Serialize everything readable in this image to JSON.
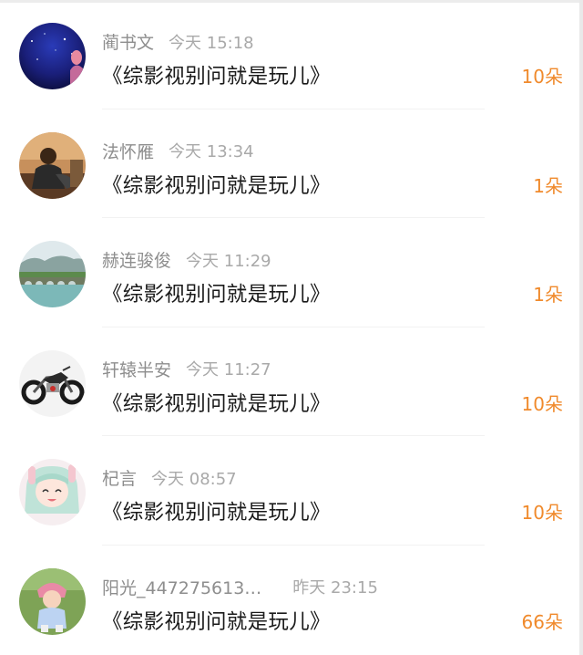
{
  "rows": [
    {
      "name": "蔺书文",
      "time": "今天 15:18",
      "title": "《综影视别问就是玩儿》",
      "amount": "10朵",
      "avatar": "night-sky-avatar-icon"
    },
    {
      "name": "法怀雁",
      "time": "今天 13:34",
      "title": "《综影视别问就是玩儿》",
      "amount": "1朵",
      "avatar": "sitting-person-avatar-icon"
    },
    {
      "name": "赫连骏俊",
      "time": "今天 11:29",
      "title": "《综影视别问就是玩儿》",
      "amount": "1朵",
      "avatar": "bridge-landscape-avatar-icon"
    },
    {
      "name": "轩辕半安",
      "time": "今天 11:27",
      "title": "《综影视别问就是玩儿》",
      "amount": "10朵",
      "avatar": "motorcycle-avatar-icon"
    },
    {
      "name": "杞言",
      "time": "今天 08:57",
      "title": "《综影视别问就是玩儿》",
      "amount": "10朵",
      "avatar": "anime-girl-avatar-icon"
    },
    {
      "name": "阳光_447275613…",
      "time": "昨天 23:15",
      "title": "《综影视别问就是玩儿》",
      "amount": "66朵",
      "avatar": "toddler-photo-avatar-icon"
    }
  ],
  "colors": {
    "accent": "#f08a2c",
    "name": "#8e8e8e",
    "time": "#a9a9a9",
    "title": "#1b1b1b"
  }
}
